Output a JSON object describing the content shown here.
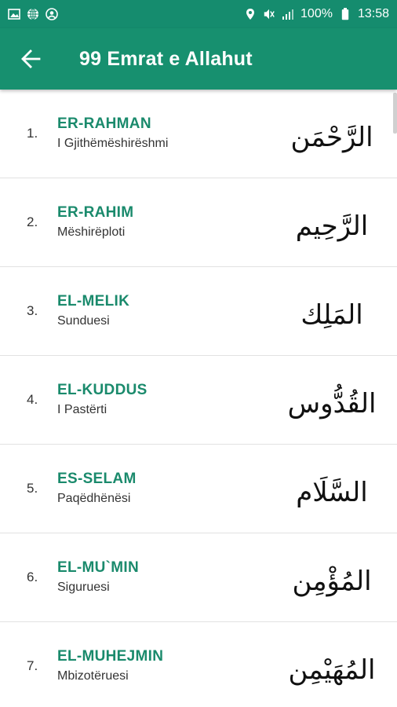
{
  "status_bar": {
    "battery": "100%",
    "time": "13:58"
  },
  "app_bar": {
    "title": "99 Emrat e Allahut"
  },
  "names": [
    {
      "number": "1.",
      "name": "ER-RAHMAN",
      "meaning": "I Gjithëmëshirëshmi",
      "arabic": "الرَّحْمَن"
    },
    {
      "number": "2.",
      "name": "ER-RAHIM",
      "meaning": "Mëshirëploti",
      "arabic": "الرَّحِيم"
    },
    {
      "number": "3.",
      "name": "EL-MELIK",
      "meaning": "Sunduesi",
      "arabic": "المَلِك"
    },
    {
      "number": "4.",
      "name": "EL-KUDDUS",
      "meaning": "I Pastërti",
      "arabic": "القُدُّوس"
    },
    {
      "number": "5.",
      "name": "ES-SELAM",
      "meaning": "Paqëdhënësi",
      "arabic": "السَّلَام"
    },
    {
      "number": "6.",
      "name": "EL-MU`MIN",
      "meaning": "Siguruesi",
      "arabic": "المُؤْمِن"
    },
    {
      "number": "7.",
      "name": "EL-MUHEJMIN",
      "meaning": "Mbizotëruesi",
      "arabic": "المُهَيْمِن"
    }
  ]
}
